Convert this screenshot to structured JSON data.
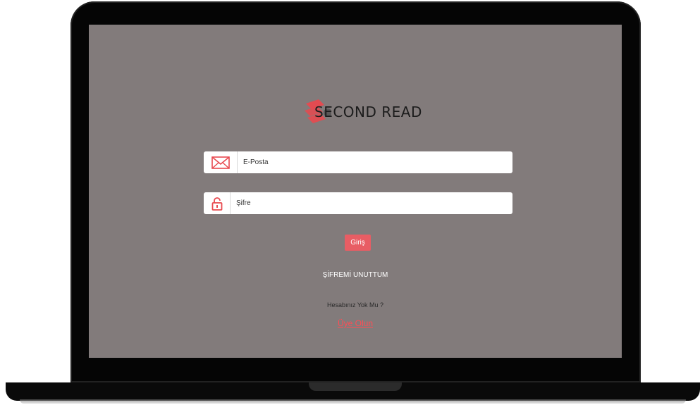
{
  "brand": {
    "name": "SECOND READ",
    "accent_color": "#e85d64"
  },
  "form": {
    "email": {
      "placeholder": "E-Posta",
      "value": "",
      "icon": "envelope-icon"
    },
    "password": {
      "placeholder": "Şifre",
      "value": "",
      "icon": "lock-icon"
    },
    "submit_label": "Giriş"
  },
  "links": {
    "forgot_password": "ŞİFREMİ UNUTTUM",
    "no_account": "Hesabınız Yok Mu ?",
    "signup": "Üye Olun"
  },
  "colors": {
    "screen_background": "#827b7b",
    "bezel": "#050505",
    "signup_link": "#ff4d55"
  }
}
